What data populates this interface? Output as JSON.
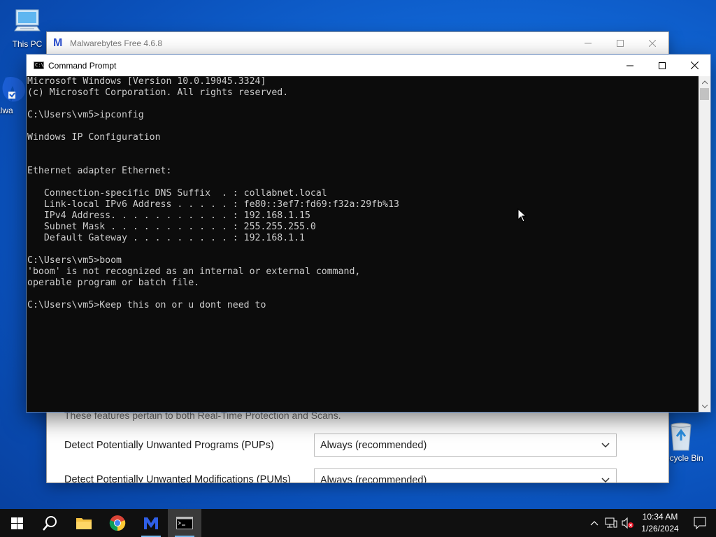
{
  "desktop": {
    "icons": [
      {
        "label": "This PC"
      },
      {
        "label": "Malwa"
      },
      {
        "label": "Recycle Bin"
      }
    ]
  },
  "malwarebytes": {
    "title": "Malwarebytes Free 4.6.8",
    "description": "These features pertain to both Real-Time Protection and Scans.",
    "rows": [
      {
        "label": "Detect Potentially Unwanted Programs (PUPs)",
        "value": "Always (recommended)"
      },
      {
        "label": "Detect Potentially Unwanted Modifications (PUMs)",
        "value": "Always (recommended)"
      }
    ]
  },
  "cmd": {
    "title": "Command Prompt",
    "lines": [
      "Microsoft Windows [Version 10.0.19045.3324]",
      "(c) Microsoft Corporation. All rights reserved.",
      "",
      "C:\\Users\\vm5>ipconfig",
      "",
      "Windows IP Configuration",
      "",
      "",
      "Ethernet adapter Ethernet:",
      "",
      "   Connection-specific DNS Suffix  . : collabnet.local",
      "   Link-local IPv6 Address . . . . . : fe80::3ef7:fd69:f32a:29fb%13",
      "   IPv4 Address. . . . . . . . . . . : 192.168.1.15",
      "   Subnet Mask . . . . . . . . . . . : 255.255.255.0",
      "   Default Gateway . . . . . . . . . : 192.168.1.1",
      "",
      "C:\\Users\\vm5>boom",
      "'boom' is not recognized as an internal or external command,",
      "operable program or batch file.",
      "",
      "C:\\Users\\vm5>Keep this on or u dont need to"
    ]
  },
  "taskbar": {
    "apps": [
      "start-icon",
      "search-icon",
      "file-explorer-icon",
      "chrome-icon",
      "malwarebytes-icon",
      "command-prompt-icon"
    ],
    "time": "10:34 AM",
    "date": "1/26/2024"
  },
  "colors": {
    "desktop": "#0a4fb8",
    "cmd_bg": "#0c0c0c",
    "cmd_fg": "#cccccc",
    "taskbar": "#101010",
    "malwarebytes_brand": "#2b4fcf"
  }
}
